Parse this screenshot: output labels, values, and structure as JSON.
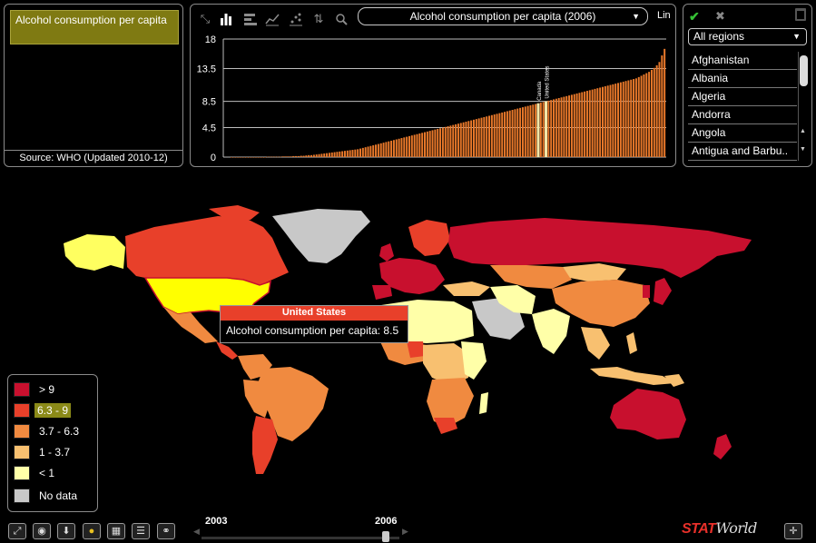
{
  "indicator_panel": {
    "title": "Alcohol consumption per capita",
    "source": "Source: WHO (Updated 2010-12)"
  },
  "chart_panel": {
    "toolbar_icons": [
      "expand-icon",
      "bar-chart-icon",
      "horizontal-bar-icon",
      "line-chart-icon",
      "scatter-icon",
      "sort-icon",
      "search-icon"
    ],
    "indicator_selected": "Alcohol consumption per capita (2006)",
    "scale_toggle": "Lin"
  },
  "chart_data": {
    "type": "bar",
    "title": "",
    "y_ticks": [
      "18",
      "13.5",
      "8.5",
      "4.5",
      "0"
    ],
    "ylim": [
      0,
      18
    ],
    "grid": true,
    "series_color": "#e8782a",
    "highlight_color": "#f3e6a8",
    "values_sorted_ascending": [
      0.0,
      0.0,
      0.0,
      0.0,
      0.0,
      0.0,
      0.0,
      0.0,
      0.0,
      0.0,
      0.0,
      0.0,
      0.0,
      0.0,
      0.05,
      0.05,
      0.05,
      0.05,
      0.05,
      0.05,
      0.1,
      0.1,
      0.1,
      0.1,
      0.15,
      0.15,
      0.15,
      0.2,
      0.2,
      0.25,
      0.3,
      0.3,
      0.35,
      0.4,
      0.45,
      0.5,
      0.55,
      0.6,
      0.65,
      0.7,
      0.75,
      0.8,
      0.85,
      0.9,
      0.95,
      1.0,
      1.05,
      1.1,
      1.15,
      1.2,
      1.3,
      1.4,
      1.5,
      1.6,
      1.7,
      1.8,
      1.9,
      2.0,
      2.1,
      2.2,
      2.3,
      2.4,
      2.5,
      2.6,
      2.7,
      2.8,
      2.9,
      3.0,
      3.1,
      3.2,
      3.3,
      3.4,
      3.5,
      3.6,
      3.7,
      3.8,
      3.9,
      4.0,
      4.1,
      4.2,
      4.3,
      4.4,
      4.5,
      4.6,
      4.7,
      4.8,
      4.9,
      5.0,
      5.1,
      5.2,
      5.3,
      5.4,
      5.5,
      5.6,
      5.7,
      5.8,
      5.9,
      6.0,
      6.1,
      6.2,
      6.3,
      6.4,
      6.5,
      6.6,
      6.7,
      6.8,
      6.9,
      7.0,
      7.1,
      7.2,
      7.3,
      7.4,
      7.5,
      7.6,
      7.7,
      7.8,
      7.9,
      8.0,
      8.1,
      8.2,
      8.3,
      8.4,
      8.5,
      8.6,
      8.7,
      8.8,
      8.9,
      9.0,
      9.1,
      9.2,
      9.3,
      9.4,
      9.5,
      9.6,
      9.7,
      9.8,
      9.9,
      10.0,
      10.1,
      10.2,
      10.3,
      10.4,
      10.5,
      10.6,
      10.7,
      10.8,
      10.9,
      11.0,
      11.1,
      11.2,
      11.3,
      11.4,
      11.5,
      11.6,
      11.7,
      11.8,
      11.9,
      12.0,
      12.2,
      12.4,
      12.6,
      12.8,
      13.0,
      13.3,
      13.6,
      14.0,
      14.5,
      15.5,
      16.5
    ],
    "highlighted_bars": [
      {
        "label": "Canada",
        "value": 8.2
      },
      {
        "label": "United States",
        "value": 8.5
      }
    ]
  },
  "country_panel": {
    "region_selected": "All regions",
    "countries": [
      "Afghanistan",
      "Albania",
      "Algeria",
      "Andorra",
      "Angola",
      "Antigua and Barbu.."
    ]
  },
  "tooltip": {
    "title": "United States",
    "body": "Alcohol consumption per capita: 8.5"
  },
  "legend": {
    "items": [
      {
        "label": "> 9",
        "color": "#c8102e"
      },
      {
        "label": "6.3 - 9",
        "color": "#e8402a"
      },
      {
        "label": "3.7 - 6.3",
        "color": "#f08a40"
      },
      {
        "label": "1 - 3.7",
        "color": "#f8c070"
      },
      {
        "label": "< 1",
        "color": "#ffffa8"
      },
      {
        "label": "No data",
        "color": "#c8c8c8"
      }
    ]
  },
  "timeline": {
    "start_year": "2003",
    "current_year": "2006"
  },
  "bottom_toolbar": {
    "buttons": [
      "fullscreen-icon",
      "eye-icon",
      "download-icon",
      "bubble-icon",
      "table-icon",
      "list-icon",
      "link-icon"
    ]
  },
  "brand": {
    "part1": "STAT",
    "part2": "World"
  }
}
